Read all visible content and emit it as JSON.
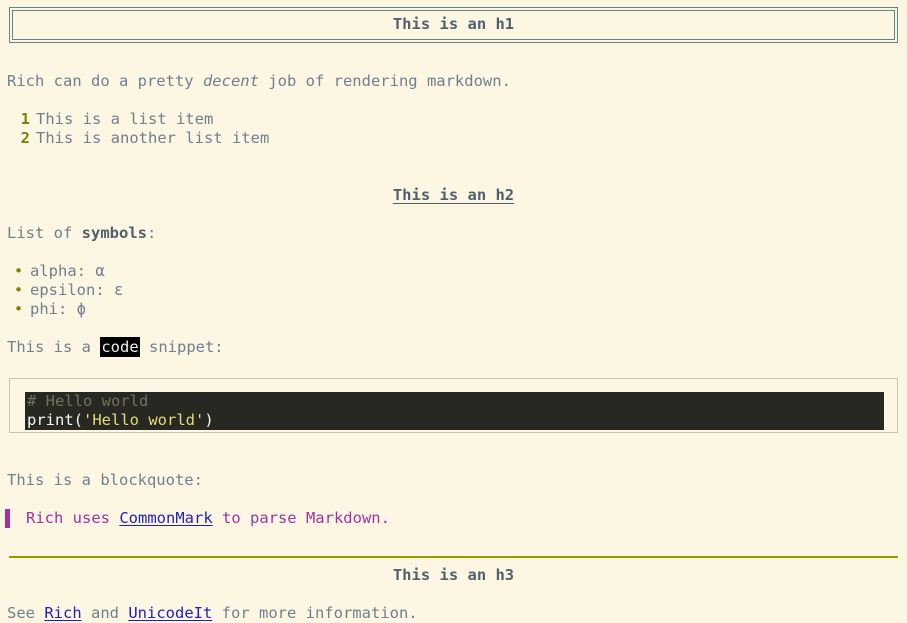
{
  "document": {
    "background_color": "#fdf6e3",
    "body_text_color": "#708090",
    "accent_olive": "#808000",
    "accent_magenta": "#a0339f",
    "link_color": "#1f1fbf",
    "heading_color": "#50616d",
    "panel_border_color": "#5f8787",
    "code_bg_color": "#272822"
  },
  "h1": {
    "text": "This is an h1"
  },
  "intro_paragraph": {
    "before_italic": "Rich can do a pretty ",
    "italic": "decent",
    "after_italic": " job of rendering markdown."
  },
  "ordered_list": {
    "items": [
      {
        "number": "1",
        "text": "This is a list item"
      },
      {
        "number": "2",
        "text": "This is another list item"
      }
    ]
  },
  "h2": {
    "text": "This is an h2"
  },
  "symbols_intro": {
    "before_bold": "List of ",
    "bold": "symbols",
    "after_bold": ":"
  },
  "bullet_list": {
    "bullet_glyph": "•",
    "items": [
      {
        "text": "alpha: α"
      },
      {
        "text": "epsilon: ε"
      },
      {
        "text": "phi: ϕ"
      }
    ]
  },
  "code_snippet_paragraph": {
    "before_code": "This is a ",
    "code": "code",
    "after_code": " snippet:"
  },
  "code_block": {
    "language": "python",
    "line1_comment": "# Hello world",
    "line2_name": "print",
    "line2_open_paren": "(",
    "line2_string": "'Hello world'",
    "line2_close_paren": ")"
  },
  "blockquote_intro": {
    "text": "This is a blockquote:"
  },
  "blockquote": {
    "before_link": "Rich uses ",
    "link_text": "CommonMark",
    "after_link": " to parse Markdown."
  },
  "h3": {
    "text": "This is an h3"
  },
  "footer_paragraph": {
    "before_link1": "See ",
    "link1_text": "Rich",
    "between_links": " and ",
    "link2_text": "UnicodeIt",
    "after_link2": " for more information."
  }
}
